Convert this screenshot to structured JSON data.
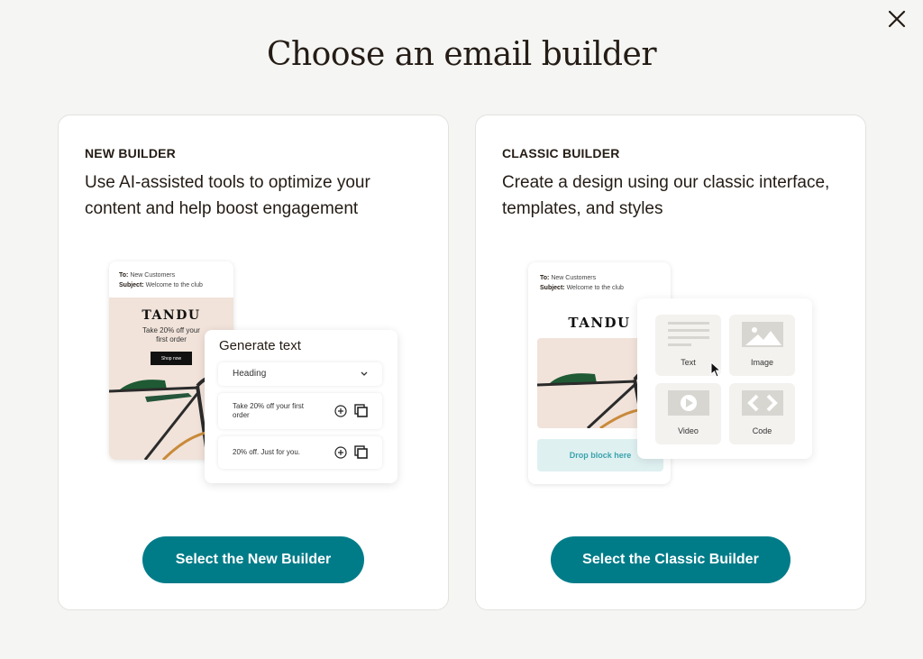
{
  "dialog": {
    "title": "Choose an email builder",
    "close_icon": "close-icon"
  },
  "colors": {
    "primary": "#007c89",
    "background": "#f5f5f3",
    "card": "#ffffff",
    "text": "#241c15"
  },
  "new_builder": {
    "eyebrow": "NEW BUILDER",
    "description": "Use AI-assisted tools to optimize your content and help boost engagement",
    "cta_label": "Select the New Builder",
    "illustration": {
      "email": {
        "to_label": "To:",
        "to_value": "New Customers",
        "subject_label": "Subject:",
        "subject_value": "Welcome to the club",
        "brand": "TANDU",
        "offer": "Take 20% off your first order",
        "shop_button": "Shop now"
      },
      "generate_panel": {
        "title": "Generate text",
        "dropdown_value": "Heading",
        "suggestions": [
          {
            "text": "Take 20% off your first order"
          },
          {
            "text": "20% off. Just for you."
          }
        ]
      }
    }
  },
  "classic_builder": {
    "eyebrow": "CLASSIC BUILDER",
    "description": "Create a design using our classic interface, templates, and styles",
    "cta_label": "Select the Classic Builder",
    "illustration": {
      "email": {
        "to_label": "To:",
        "to_value": "New Customers",
        "subject_label": "Subject:",
        "subject_value": "Welcome to the club",
        "brand": "TANDU",
        "drop_zone": "Drop block here"
      },
      "blocks": [
        {
          "label": "Text",
          "icon": "text-lines-icon"
        },
        {
          "label": "Image",
          "icon": "image-icon"
        },
        {
          "label": "Video",
          "icon": "video-play-icon"
        },
        {
          "label": "Code",
          "icon": "code-brackets-icon"
        }
      ]
    }
  }
}
